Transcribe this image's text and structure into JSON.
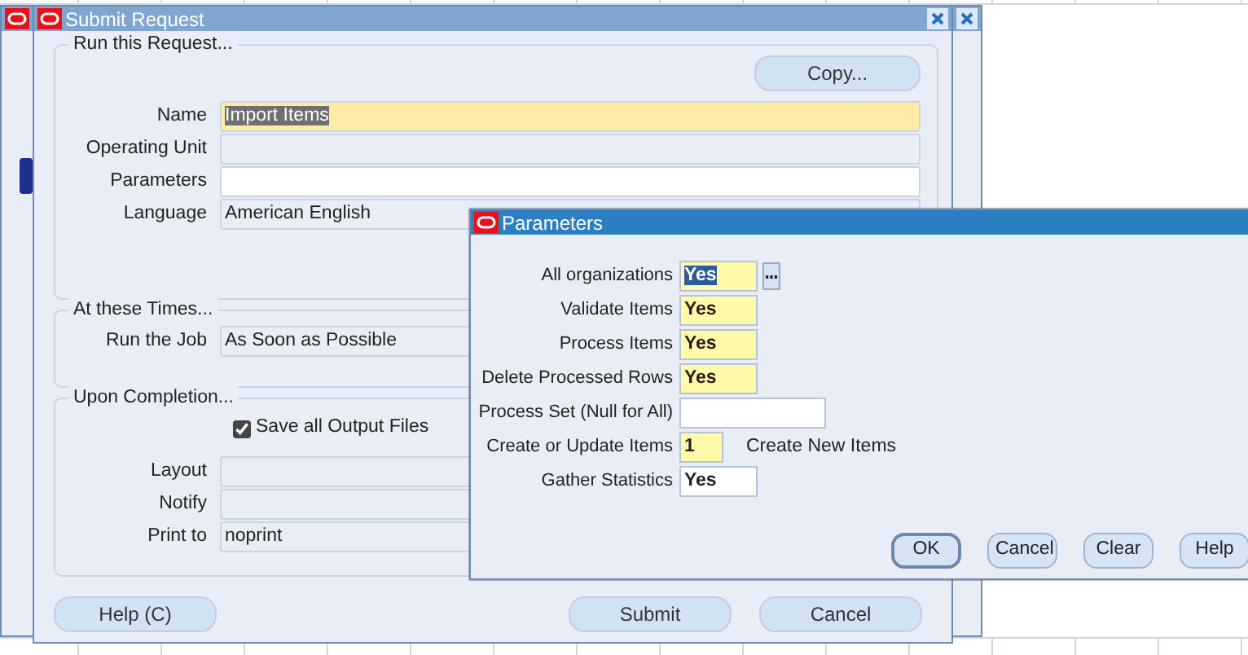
{
  "submit_request": {
    "title": "Submit Request",
    "sections": [
      {
        "legend": "Run this Request...",
        "button": "Copy...",
        "fields": [
          {
            "label": "Name",
            "value": "Import Items",
            "kind": "required",
            "highlighted": true
          },
          {
            "label": "Operating Unit",
            "kind": "display"
          },
          {
            "label": "Parameters",
            "kind": "entry"
          },
          {
            "label": "Language",
            "value": "American English",
            "kind": "display",
            "highlighted": false
          }
        ]
      },
      {
        "legend": "At these Times...",
        "fields": [
          {
            "label": "Run the Job",
            "value": "As Soon as Possible",
            "kind": "display",
            "highlighted": false
          }
        ]
      },
      {
        "legend": "Upon Completion...",
        "checkbox": {
          "label": "Save all Output Files",
          "checked": true
        },
        "fields": [
          {
            "label": "Layout",
            "kind": "display"
          },
          {
            "label": "Notify",
            "kind": "display"
          },
          {
            "label": "Print to",
            "value": "noprint",
            "kind": "display",
            "highlighted": false
          }
        ]
      }
    ],
    "buttons": [
      "Help (C)",
      "Submit",
      "Cancel"
    ]
  },
  "parameters_dialog": {
    "title": "Parameters",
    "fields": [
      {
        "label": "All organizations",
        "value": "Yes",
        "kind": "flag",
        "required": true,
        "highlighted": true,
        "lov": true
      },
      {
        "label": "Validate Items",
        "value": "Yes",
        "kind": "flag",
        "required": true,
        "highlighted": false
      },
      {
        "label": "Process Items",
        "value": "Yes",
        "kind": "flag",
        "required": true,
        "highlighted": false
      },
      {
        "label": "Delete Processed Rows",
        "value": "Yes",
        "kind": "flag",
        "required": true,
        "highlighted": false
      },
      {
        "label": "Process Set (Null for All)",
        "kind": "text",
        "required": false
      },
      {
        "label": "Create or Update Items",
        "value": "1",
        "kind": "number",
        "required": true,
        "highlighted": false,
        "note": "Create New Items"
      },
      {
        "label": "Gather Statistics",
        "value": "Yes",
        "kind": "flag",
        "required": false,
        "highlighted": false
      }
    ],
    "buttons": [
      {
        "label": "OK",
        "default": true
      },
      {
        "label": "Cancel",
        "default": false
      },
      {
        "label": "Clear",
        "default": false
      },
      {
        "label": "Help",
        "default": false
      }
    ]
  }
}
